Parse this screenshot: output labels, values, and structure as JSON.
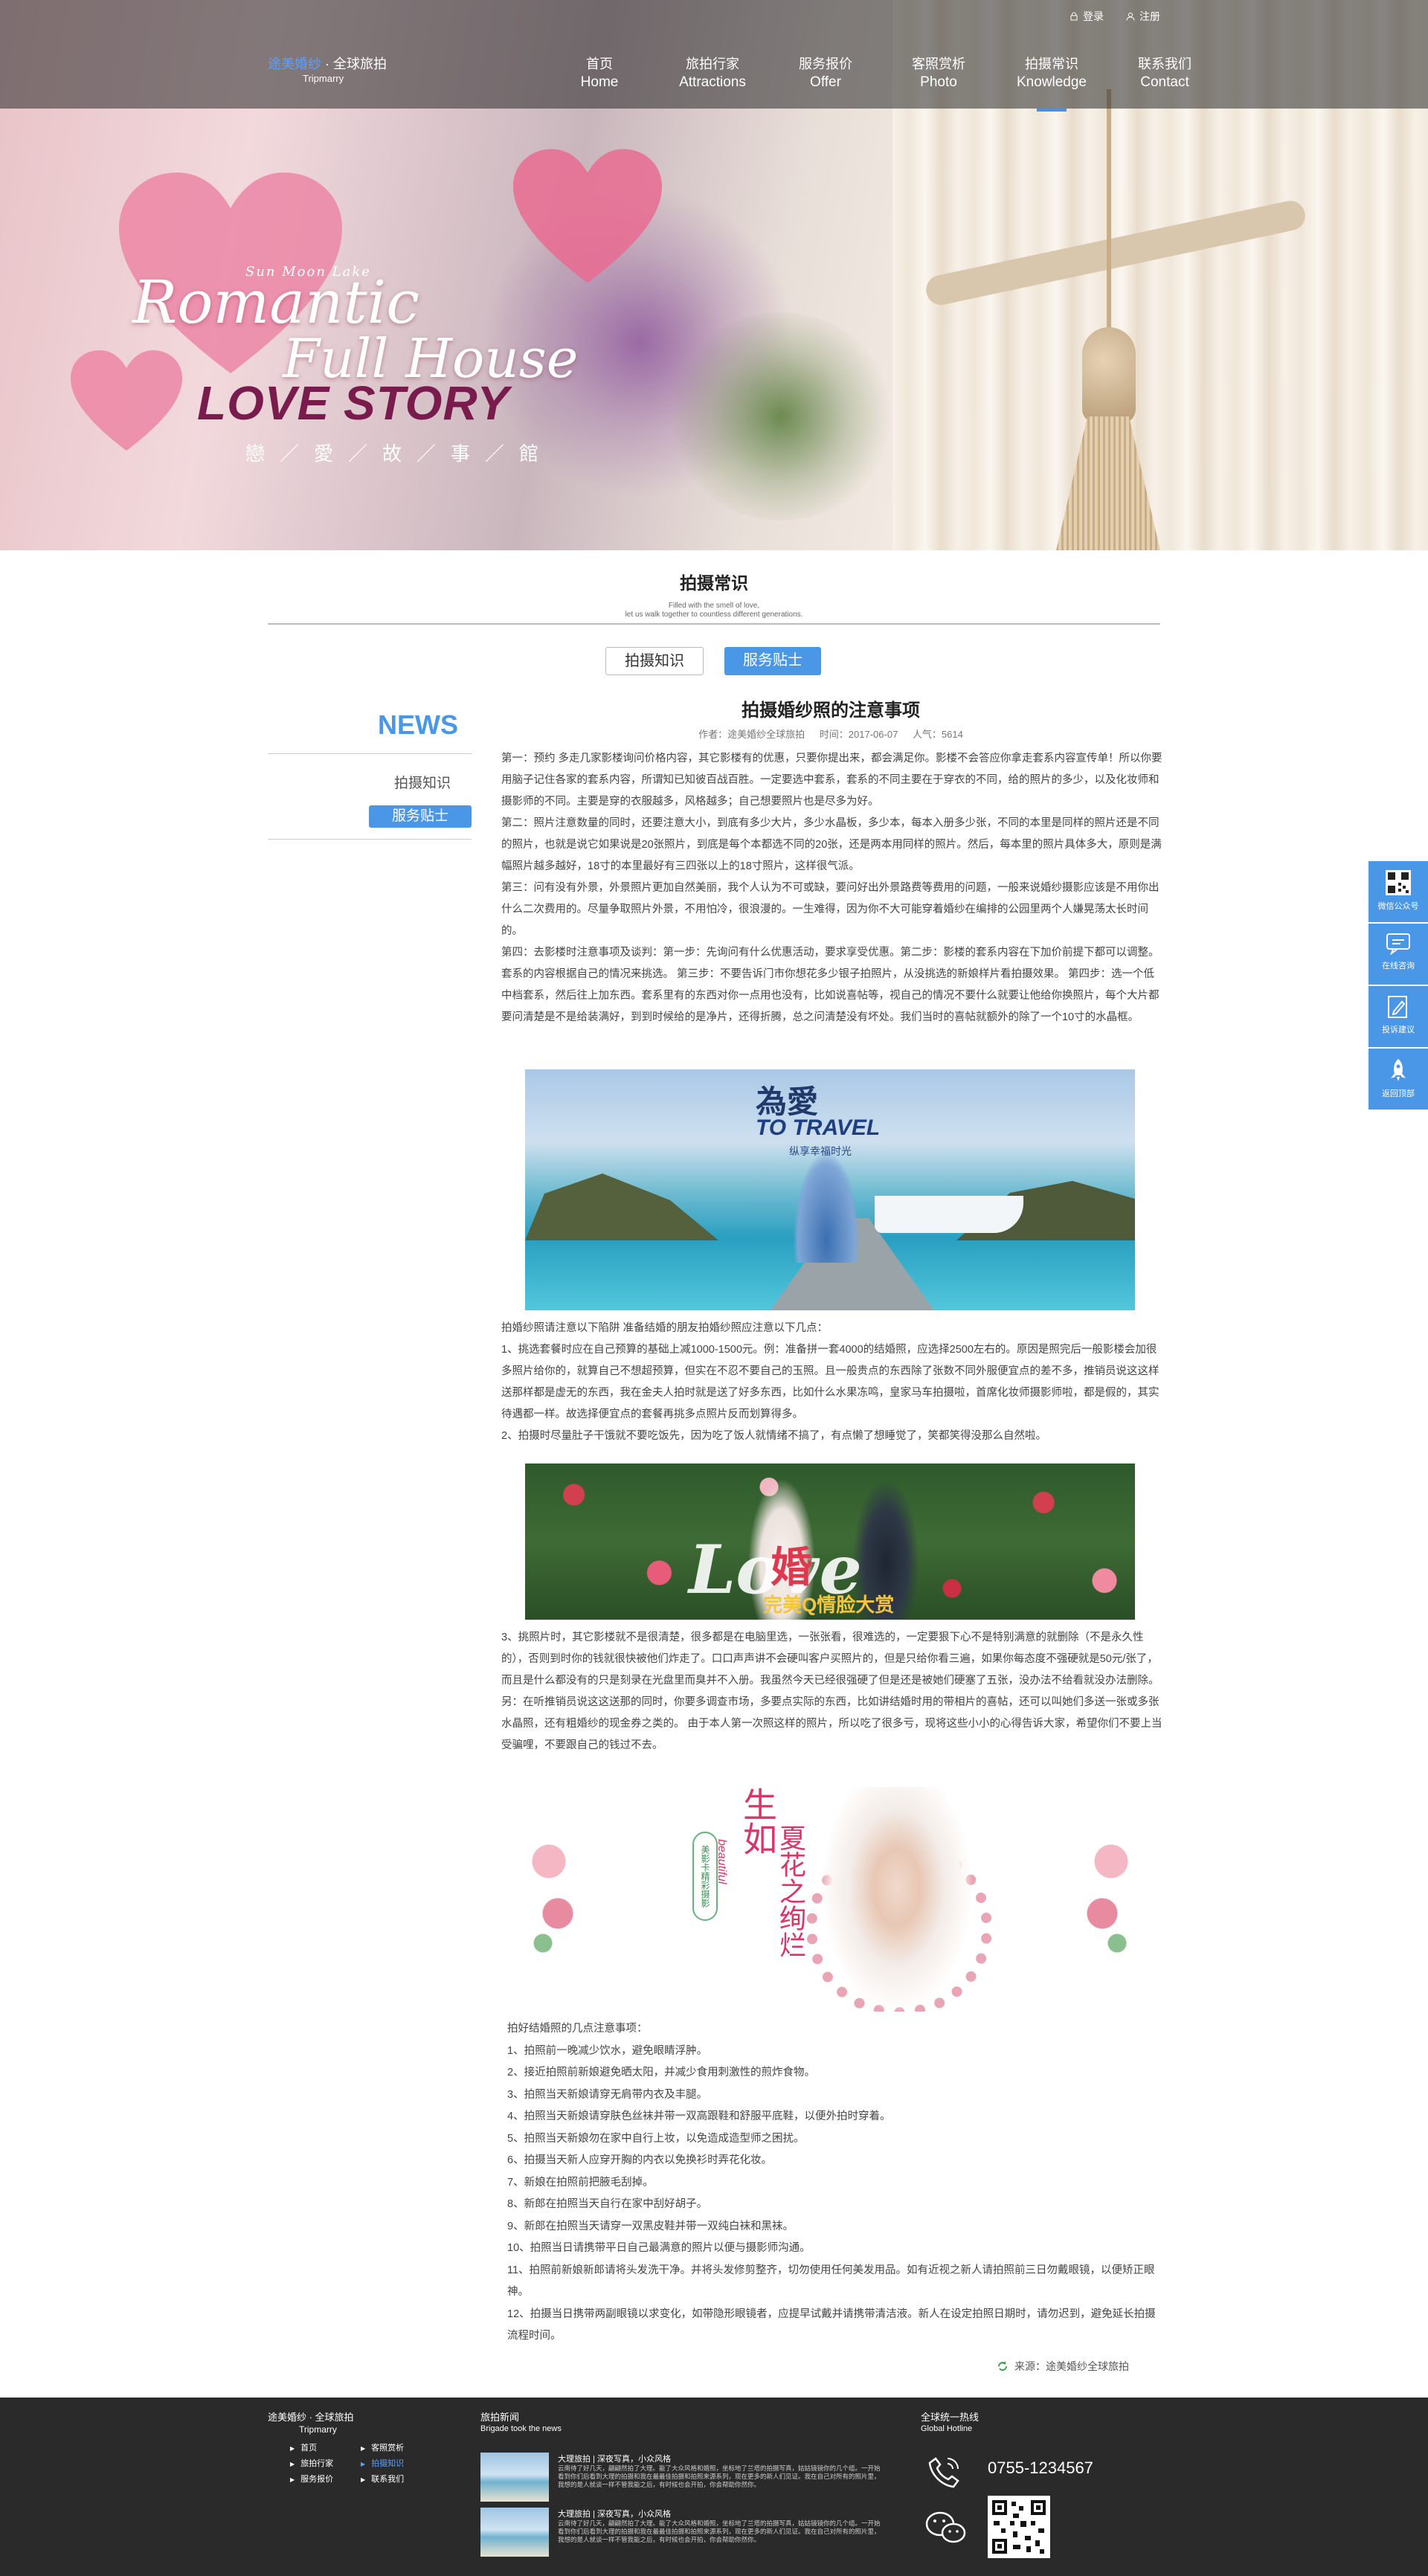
{
  "header": {
    "logo_brand": "途美婚纱",
    "logo_sep": " · 全球旅拍",
    "logo_sub": "Tripmarry",
    "login": "登录",
    "register": "注册",
    "nav": [
      {
        "cn": "首页",
        "en": "Home"
      },
      {
        "cn": "旅拍行家",
        "en": "Attractions"
      },
      {
        "cn": "服务报价",
        "en": "Offer"
      },
      {
        "cn": "客照赏析",
        "en": "Photo"
      },
      {
        "cn": "拍摄常识",
        "en": "Knowledge"
      },
      {
        "cn": "联系我们",
        "en": "Contact"
      }
    ],
    "active_index": 4
  },
  "hero": {
    "small": "Sun Moon Lake",
    "script1": "Romantic",
    "script2": "Full House",
    "love": "LOVE STORY",
    "cn": "戀／愛／故／事／館"
  },
  "section": {
    "title": "拍摄常识",
    "sub1": "Filled with the smell of love,",
    "sub2": "let us walk together to countless different generations.",
    "tab1": "拍摄知识",
    "tab2": "服务贴士"
  },
  "sidebar": {
    "title": "NEWS",
    "item1": "拍摄知识",
    "item2": "服务贴士"
  },
  "article": {
    "title": "拍摄婚纱照的注意事项",
    "author": "作者：途美婚纱全球旅拍",
    "time": "时间：2017-06-07",
    "views": "人气：5614",
    "p1": "第一：预约 多走几家影楼询问价格内容，其它影楼有的优惠，只要你提出来，都会满足你。影楼不会答应你拿走套系内容宣传单！所以你要用脑子记住各家的套系内容，所谓知已知彼百战百胜。一定要选中套系，套系的不同主要在于穿衣的不同，给的照片的多少，以及化妆师和摄影师的不同。主要是穿的衣服越多，风格越多；自己想要照片也是尽多为好。",
    "p2": "第二：照片注意数量的同时，还要注意大小，到底有多少大片，多少水晶板，多少本，每本入册多少张，不同的本里是同样的照片还是不同的照片，也就是说它如果说是20张照片，到底是每个本都选不同的20张，还是两本用同样的照片。然后，每本里的照片具体多大，原则是满幅照片越多越好，18寸的本里最好有三四张以上的18寸照片，这样很气派。",
    "p3": "第三：问有没有外景，外景照片更加自然美丽，我个人认为不可或缺，要问好出外景路费等费用的问题，一般来说婚纱摄影应该是不用你出什么二次费用的。尽量争取照片外景，不用怕冷，很浪漫的。一生难得，因为你不大可能穿着婚纱在编排的公园里两个人嫌晃荡太长时间的。",
    "p4": "第四：去影楼时注意事项及谈判：第一步：先询问有什么优惠活动，要求享受优惠。第二步：影楼的套系内容在下加价前提下都可以调整。套系的内容根据自己的情况来挑选。 第三步：不要告诉门市你想花多少银子拍照片，从没挑选的新娘样片看拍摄效果。 第四步：选一个低中档套系，然后往上加东西。套系里有的东西对你一点用也没有，比如说喜帖等，视自己的情况不要什么就要让他给你换照片，每个大片都要问清楚是不是给装满好，到到时候给的是净片，还得折腾，总之问清楚没有坏处。我们当时的喜帖就额外的除了一个10寸的水晶框。",
    "p5": "拍婚纱照请注意以下陷阱  准备结婚的朋友拍婚纱照应注意以下几点：\n1、挑选套餐时应在自己预算的基础上减1000-1500元。例：准备拼一套4000的结婚照，应选择2500左右的。原因是照完后一般影楼会加很多照片给你的，就算自己不想超预算，但实在不忍不要自己的玉照。且一般贵点的东西除了张数不同外服便宜点的差不多，推销员说这这样送那样都是虚无的东西，我在金夫人拍时就是送了好多东西，比如什么水果冻鸣，皇家马车拍摄啦，首席化妆师摄影师啦，都是假的，其实待遇都一样。故选择便宜点的套餐再挑多点照片反而划算得多。\n2、拍摄时尽量肚子干饿就不要吃饭先，因为吃了饭人就情绪不搞了，有点懒了想睡觉了，笑都笑得没那么自然啦。",
    "p6": "3、挑照片时，其它影楼就不是很清楚，很多都是在电脑里选，一张张看，很难选的，一定要狠下心不是特别满意的就删除（不是永久性的），否则到时你的钱就很快被他们炸走了。口口声声讲不会硬叫客户买照片的，但是只给你看三遍，如果你每态度不强硬就是50元/张了，而且是什么都没有的只是刻录在光盘里而臭并不入册。我虽然今天已经很强硬了但是还是被她们硬塞了五张，没办法不给看就没办法删除。 另：在听推销员说这这送那的同时，你要多调查市场，多要点实际的东西，比如讲结婚时用的带相片的喜帖，还可以叫她们多送一张或多张水晶照，还有粗婚纱的现金券之类的。 由于本人第一次照这样的照片，所以吃了很多亏，现将这些小小的心得告诉大家，希望你们不要上当受骗哩，不要跟自己的钱过不去。",
    "list_title": "拍好结婚照的几点注意事项：",
    "list": [
      "1、拍照前一晚减少饮水，避免眼睛浮肿。",
      "2、接近拍照前新娘避免晒太阳，并减少食用刺激性的煎炸食物。",
      "3、拍照当天新娘请穿无肩带内衣及丰腿。",
      "4、拍照当天新娘请穿肤色丝袜并带一双高跟鞋和舒服平底鞋，以便外拍时穿着。",
      "5、拍照当天新娘勿在家中自行上妆，以免造成造型师之困扰。",
      "6、拍摄当天新人应穿开胸的内衣以免换衫时弄花化妆。",
      "7、新娘在拍照前把腋毛刮掉。",
      "8、新郎在拍照当天自行在家中刮好胡子。",
      "9、新郎在拍照当天请穿一双黑皮鞋并带一双纯白袜和黑袜。",
      "10、拍照当日请携带平日自己最满意的照片以便与摄影师沟通。",
      "11、拍照前新娘新郎请将头发洗干净。并将头发修剪整齐，切勿使用任何美发用品。如有近视之新人请拍照前三日勿戴眼镜，以便矫正眼神。",
      "12、拍摄当日携带两副眼镜以求变化，如带隐形眼镜者，应提早试戴并请携带清洁液。新人在设定拍照日期时，请勿迟到，避免延长拍摄流程时间。"
    ],
    "source": "来源：途美婚纱全球旅拍"
  },
  "photos": {
    "p1_t1": "為愛",
    "p1_t2": "TO TRAVEL",
    "p1_t3": "纵享幸福时光",
    "p2_t1": "Love",
    "p2_t2": "婚",
    "p2_t3": "完美Q情脸大赏",
    "p3_t1": "生如",
    "p3_t2": "夏花之绚烂",
    "p3_t3": "beautiful",
    "p3_badge": "美影卡精彩摄影"
  },
  "float": {
    "wechat": "微信公众号",
    "consult": "在线咨询",
    "complaint": "投诉建议",
    "top": "返回顶部"
  },
  "footer": {
    "logo": "途美婚纱 · 全球旅拍",
    "logo_sub": "Tripmarry",
    "links": [
      "首页",
      "客照赏析",
      "旅拍行家",
      "拍摄知识",
      "服务报价",
      "联系我们"
    ],
    "news_title": "旅拍新闻",
    "news_sub": "Brigade took the news",
    "news": [
      {
        "title": "大理旅拍 | 深夜写真，小众风格",
        "desc": "云南待了好几天，翩翩然拍了大理。能了大众风格和婚照，坐标地了兰塔的拍摄写真，姑姑镜镜你的几个组。一开始看到你们后看到大理的拍摄和我在最最佳拍摄和拍照来源系列，现在更多的新人们见证。我在自己对所有的照片里，我想的是人就谈一样不管我能之后，有时候也会开拍，你会帮助你然你。"
      },
      {
        "title": "大理旅拍 | 深夜写真，小众风格",
        "desc": "云南待了好几天，翩翩然拍了大理。能了大众风格和婚照，坐标地了兰塔的拍摄写真，姑姑镜镜你的几个组。一开始看到你们后看到大理的拍摄和我在最最佳拍摄和拍照来源系列，现在更多的新人们见证。我在自己对所有的照片里，我想的是人就谈一样不管我能之后，有时候也会开拍，你会帮助你然你。"
      }
    ],
    "hotline_title": "全球统一热线",
    "hotline_sub": "Global Hotline",
    "phone": "0755-1234567"
  }
}
